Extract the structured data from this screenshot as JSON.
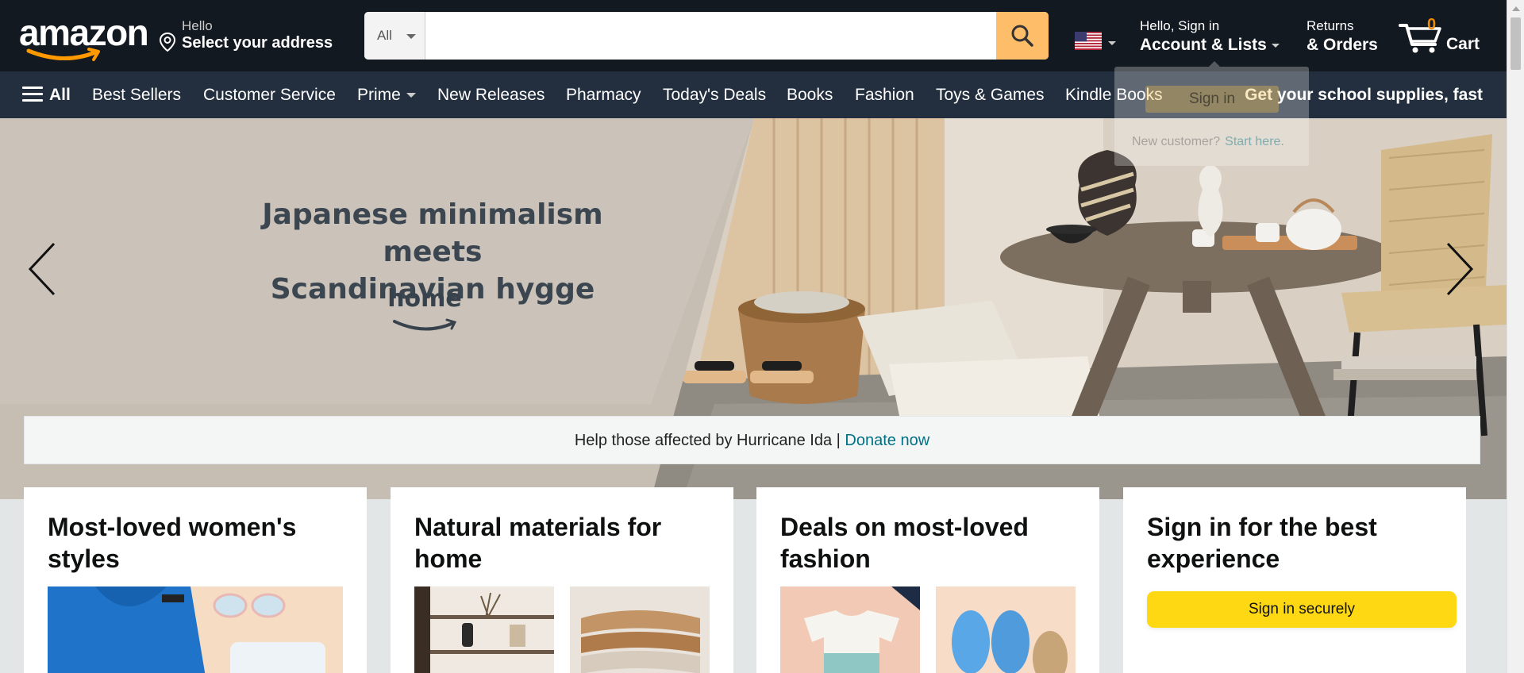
{
  "header": {
    "logo_text": "amazon",
    "address_line1": "Hello",
    "address_line2": "Select your address",
    "search_category": "All",
    "search_placeholder": "",
    "account_line1": "Hello, Sign in",
    "account_line2": "Account & Lists",
    "orders_line1": "Returns",
    "orders_line2": "& Orders",
    "cart_count": "0",
    "cart_label": "Cart"
  },
  "subnav": {
    "all_label": "All",
    "items": [
      "Best Sellers",
      "Customer Service",
      "Prime",
      "New Releases",
      "Pharmacy",
      "Today's Deals",
      "Books",
      "Fashion",
      "Toys & Games",
      "Kindle Books"
    ],
    "promo": "Get your school supplies, fast"
  },
  "hero": {
    "title_line1": "Japanese minimalism meets",
    "title_line2": "Scandinavian hygge",
    "brand": "home"
  },
  "donate": {
    "text": "Help those affected by Hurricane Ida | ",
    "link": "Donate now"
  },
  "cards": [
    {
      "title_line1": "Most-loved women's",
      "title_line2": "styles"
    },
    {
      "title_line1": "Natural materials for",
      "title_line2": "home"
    },
    {
      "title_line1": "Deals on most-loved",
      "title_line2": "fashion"
    },
    {
      "title_line1": "Sign in for the best",
      "title_line2": "experience",
      "button": "Sign in securely"
    }
  ],
  "flyout": {
    "button": "Sign in",
    "text": "New customer?",
    "link": "Start here."
  },
  "colors": {
    "nav_dark": "#131921",
    "nav_sub": "#232f3e",
    "search_button": "#febd69",
    "cart_count": "#f08804",
    "link": "#007185",
    "signin_button": "#ffd814"
  }
}
